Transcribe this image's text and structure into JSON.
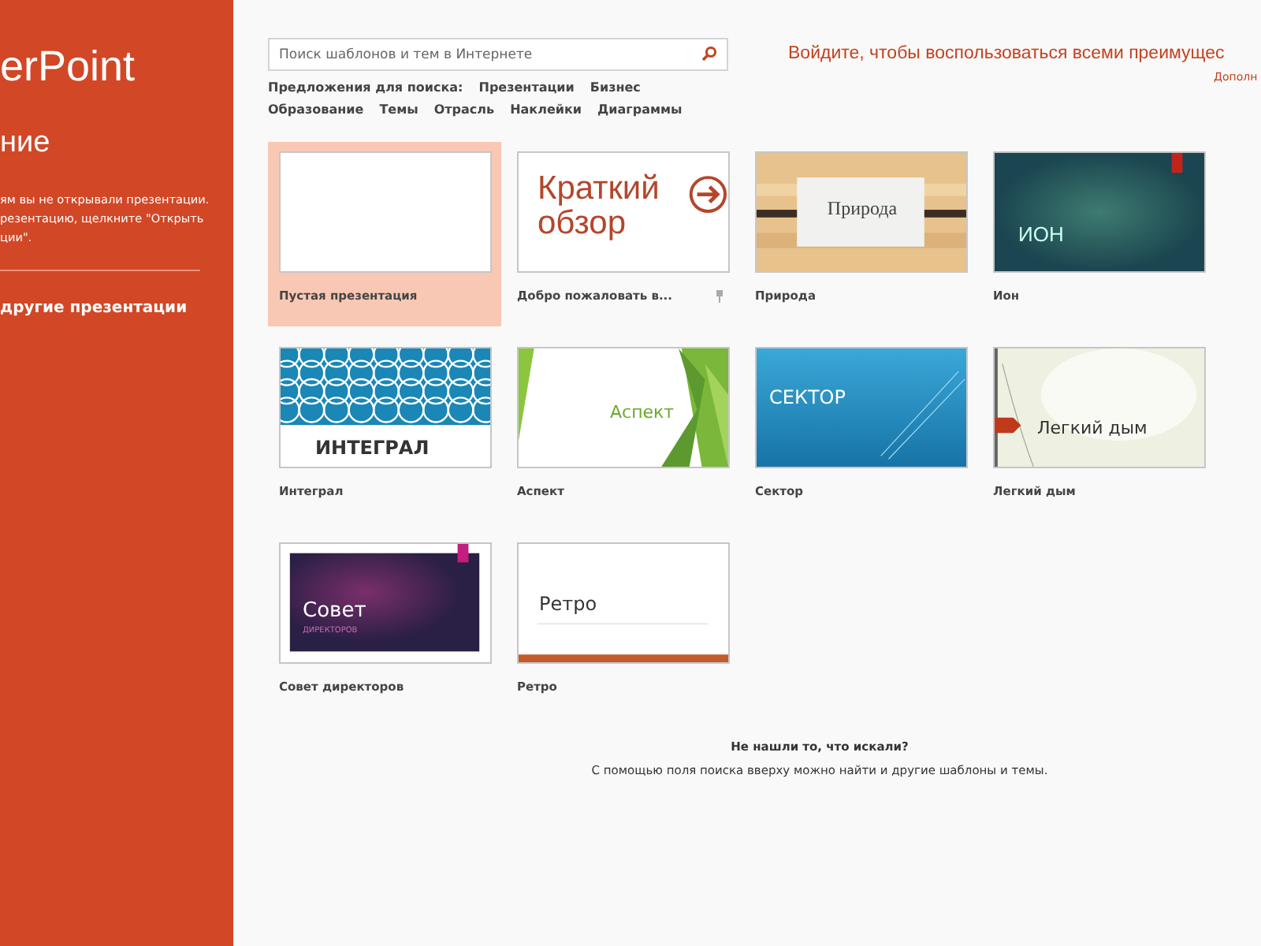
{
  "sidebar": {
    "app_title": "erPoint",
    "section_title": "ние",
    "message_lines": [
      "ям вы не открывали презентации.",
      "резентацию, щелкните \"Открыть",
      "ции\"."
    ],
    "open_link": "другие презентации"
  },
  "search": {
    "placeholder": "Поиск шаблонов и тем в Интернете"
  },
  "suggestions": {
    "label": "Предложения для поиска:",
    "items": [
      "Презентации",
      "Бизнес",
      "Образование",
      "Темы",
      "Отрасль",
      "Наклейки",
      "Диаграммы"
    ]
  },
  "sign_in": {
    "text": "Войдите, чтобы воспользоваться всеми преимущес",
    "more_link": "Дополн"
  },
  "templates": [
    {
      "kind": "blank",
      "label": "Пустая презентация",
      "selected": true,
      "pinned": false
    },
    {
      "kind": "tour",
      "label": "Добро пожаловать в...",
      "thumb_title": "Краткий обзор",
      "selected": false,
      "pinned": true
    },
    {
      "kind": "nature",
      "label": "Природа",
      "thumb_title": "Природа",
      "selected": false,
      "pinned": false
    },
    {
      "kind": "ion",
      "label": "Ион",
      "thumb_title": "ИОН",
      "selected": false,
      "pinned": false
    },
    {
      "kind": "integral",
      "label": "Интеграл",
      "thumb_title": "ИНТЕГРАЛ",
      "selected": false,
      "pinned": false
    },
    {
      "kind": "aspect",
      "label": "Аспект",
      "thumb_title": "Аспект",
      "selected": false,
      "pinned": false
    },
    {
      "kind": "sector",
      "label": "Сектор",
      "thumb_title": "СЕКТОР",
      "selected": false,
      "pinned": false
    },
    {
      "kind": "smoke",
      "label": "Легкий дым",
      "thumb_title": "Легкий дым",
      "selected": false,
      "pinned": false
    },
    {
      "kind": "board",
      "label": "Совет директоров",
      "thumb_title": "Совет",
      "thumb_subtitle": "ДИРЕКТОРОВ",
      "selected": false,
      "pinned": false
    },
    {
      "kind": "retro",
      "label": "Ретро",
      "thumb_title": "Ретро",
      "selected": false,
      "pinned": false
    }
  ],
  "not_found": {
    "title": "Не нашли то, что искали?",
    "hint": "С помощью поля поиска вверху можно найти и другие шаблоны и темы."
  }
}
